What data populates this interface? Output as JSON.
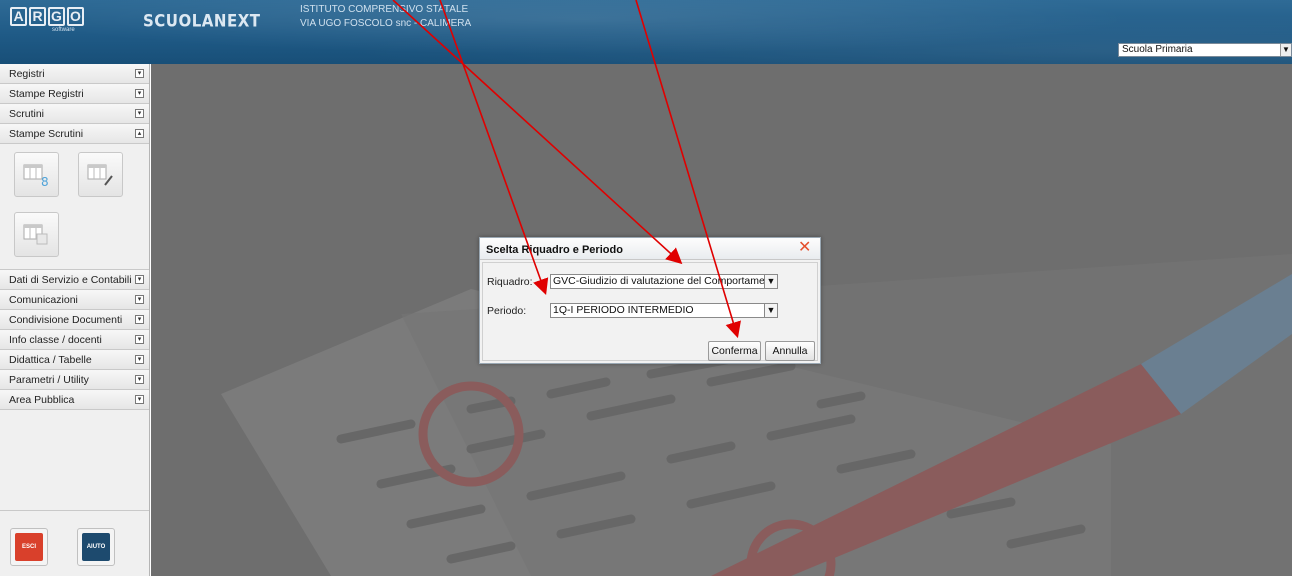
{
  "header": {
    "logo_letters": [
      "A",
      "R",
      "G",
      "O"
    ],
    "logo_sub": "software",
    "app_name": "SCUOLANEXT",
    "school_line1": "ISTITUTO COMPRENSIVO STATALE",
    "school_line2": "VIA UGO FOSCOLO snc - CALIMERA",
    "school_type_selected": "Scuola Primaria"
  },
  "sidebar": {
    "items_top": [
      {
        "label": "Registri",
        "toggle": "▾"
      },
      {
        "label": "Stampe Registri",
        "toggle": "▾"
      },
      {
        "label": "Scrutini",
        "toggle": "▾"
      },
      {
        "label": "Stampe Scrutini",
        "toggle": "▴"
      }
    ],
    "items_bottom": [
      {
        "label": "Dati di Servizio e Contabili",
        "toggle": "▾"
      },
      {
        "label": "Comunicazioni",
        "toggle": "▾"
      },
      {
        "label": "Condivisione Documenti",
        "toggle": "▾"
      },
      {
        "label": "Info classe / docenti",
        "toggle": "▾"
      },
      {
        "label": "Didattica / Tabelle",
        "toggle": "▾"
      },
      {
        "label": "Parametri / Utility",
        "toggle": "▾"
      },
      {
        "label": "Area Pubblica",
        "toggle": "▾"
      }
    ],
    "exit_label": "ESCI",
    "help_label": "AIUTO"
  },
  "dialog": {
    "title": "Scelta Riquadro e Periodo",
    "riquadro_label": "Riquadro:",
    "riquadro_value": "GVC-Giudizio di valutazione del Comportamento",
    "periodo_label": "Periodo:",
    "periodo_value": "1Q-I PERIODO INTERMEDIO",
    "confirm_label": "Conferma",
    "cancel_label": "Annulla"
  },
  "colors": {
    "header_bg": "#1f5a86",
    "arrow": "#e00000",
    "close_icon": "#e5502e"
  }
}
